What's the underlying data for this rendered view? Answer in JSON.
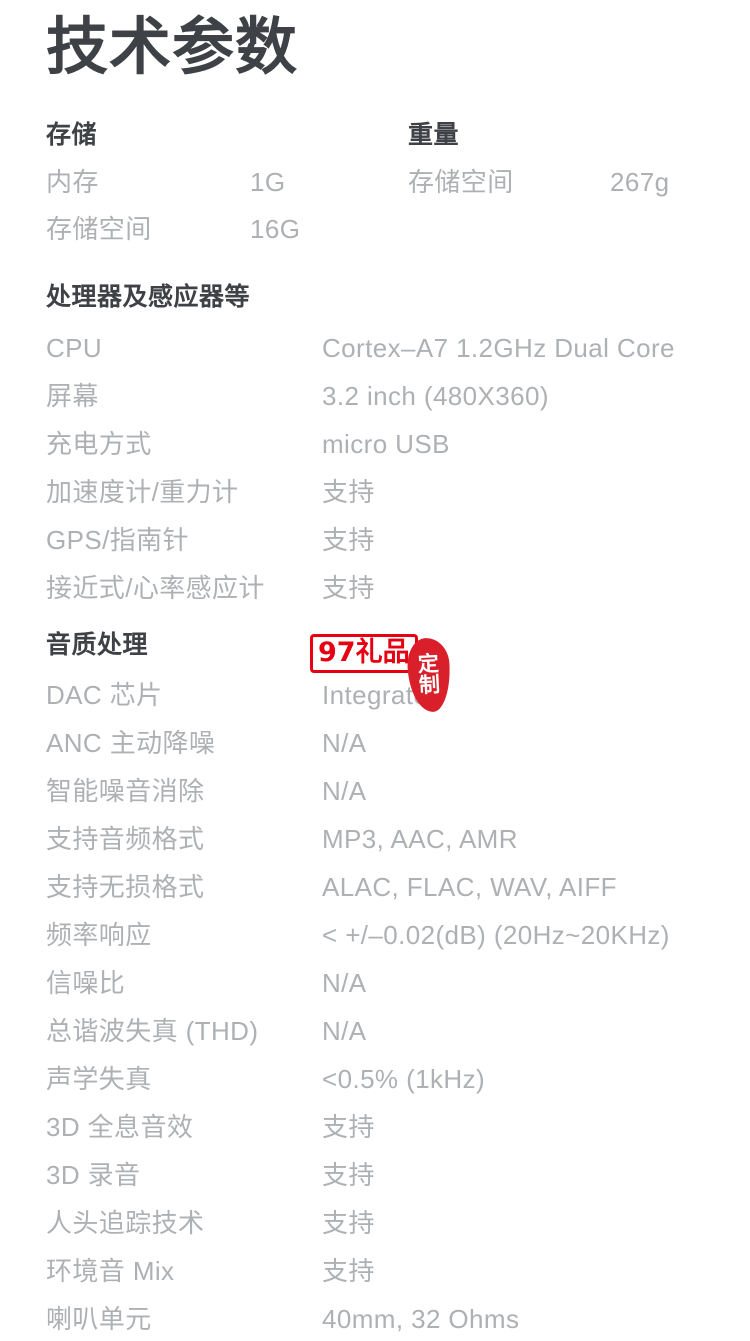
{
  "page": {
    "title": "技术参数",
    "background_color": "#ffffff",
    "heading_color": "#3e4145",
    "body_color": "#aeb1b4",
    "watermark_color": "#e60012"
  },
  "sections": {
    "storage": {
      "heading": "存储",
      "rows": [
        {
          "label": "内存",
          "value": "1G"
        },
        {
          "label": "存储空间",
          "value": "16G"
        }
      ]
    },
    "weight": {
      "heading": "重量",
      "rows": [
        {
          "label": "存储空间",
          "value": "267g"
        }
      ]
    },
    "processor": {
      "heading": "处理器及感应器等",
      "rows": [
        {
          "label": "CPU",
          "value": "Cortex–A7 1.2GHz Dual Core"
        },
        {
          "label": "屏幕",
          "value": "3.2 inch (480X360)"
        },
        {
          "label": "充电方式",
          "value": "micro USB"
        },
        {
          "label": "加速度计/重力计",
          "value": "支持"
        },
        {
          "label": "GPS/指南针",
          "value": "支持"
        },
        {
          "label": "接近式/心率感应计",
          "value": "支持"
        }
      ]
    },
    "audio": {
      "heading": "音质处理",
      "rows": [
        {
          "label": "DAC 芯片",
          "value": "Integrated"
        },
        {
          "label": "ANC 主动降噪",
          "value": "N/A"
        },
        {
          "label": "智能噪音消除",
          "value": "N/A"
        },
        {
          "label": "支持音频格式",
          "value": "MP3, AAC, AMR"
        },
        {
          "label": "支持无损格式",
          "value": "ALAC, FLAC, WAV, AIFF"
        },
        {
          "label": "频率响应",
          "value": "< +/–0.02(dB) (20Hz~20KHz)"
        },
        {
          "label": "信噪比",
          "value": "N/A"
        },
        {
          "label": "总谐波失真 (THD)",
          "value": "N/A"
        },
        {
          "label": "声学失真",
          "value": "<0.5% (1kHz)"
        },
        {
          "label": "3D 全息音效",
          "value": "支持"
        },
        {
          "label": "3D 录音",
          "value": "支持"
        },
        {
          "label": "人头追踪技术",
          "value": "支持"
        },
        {
          "label": "环境音 Mix",
          "value": "支持"
        },
        {
          "label": "喇叭单元",
          "value": "40mm, 32 Ohms"
        }
      ]
    }
  },
  "watermark": {
    "box_text": "97礼品",
    "seal_char_1": "定",
    "seal_char_2": "制"
  }
}
